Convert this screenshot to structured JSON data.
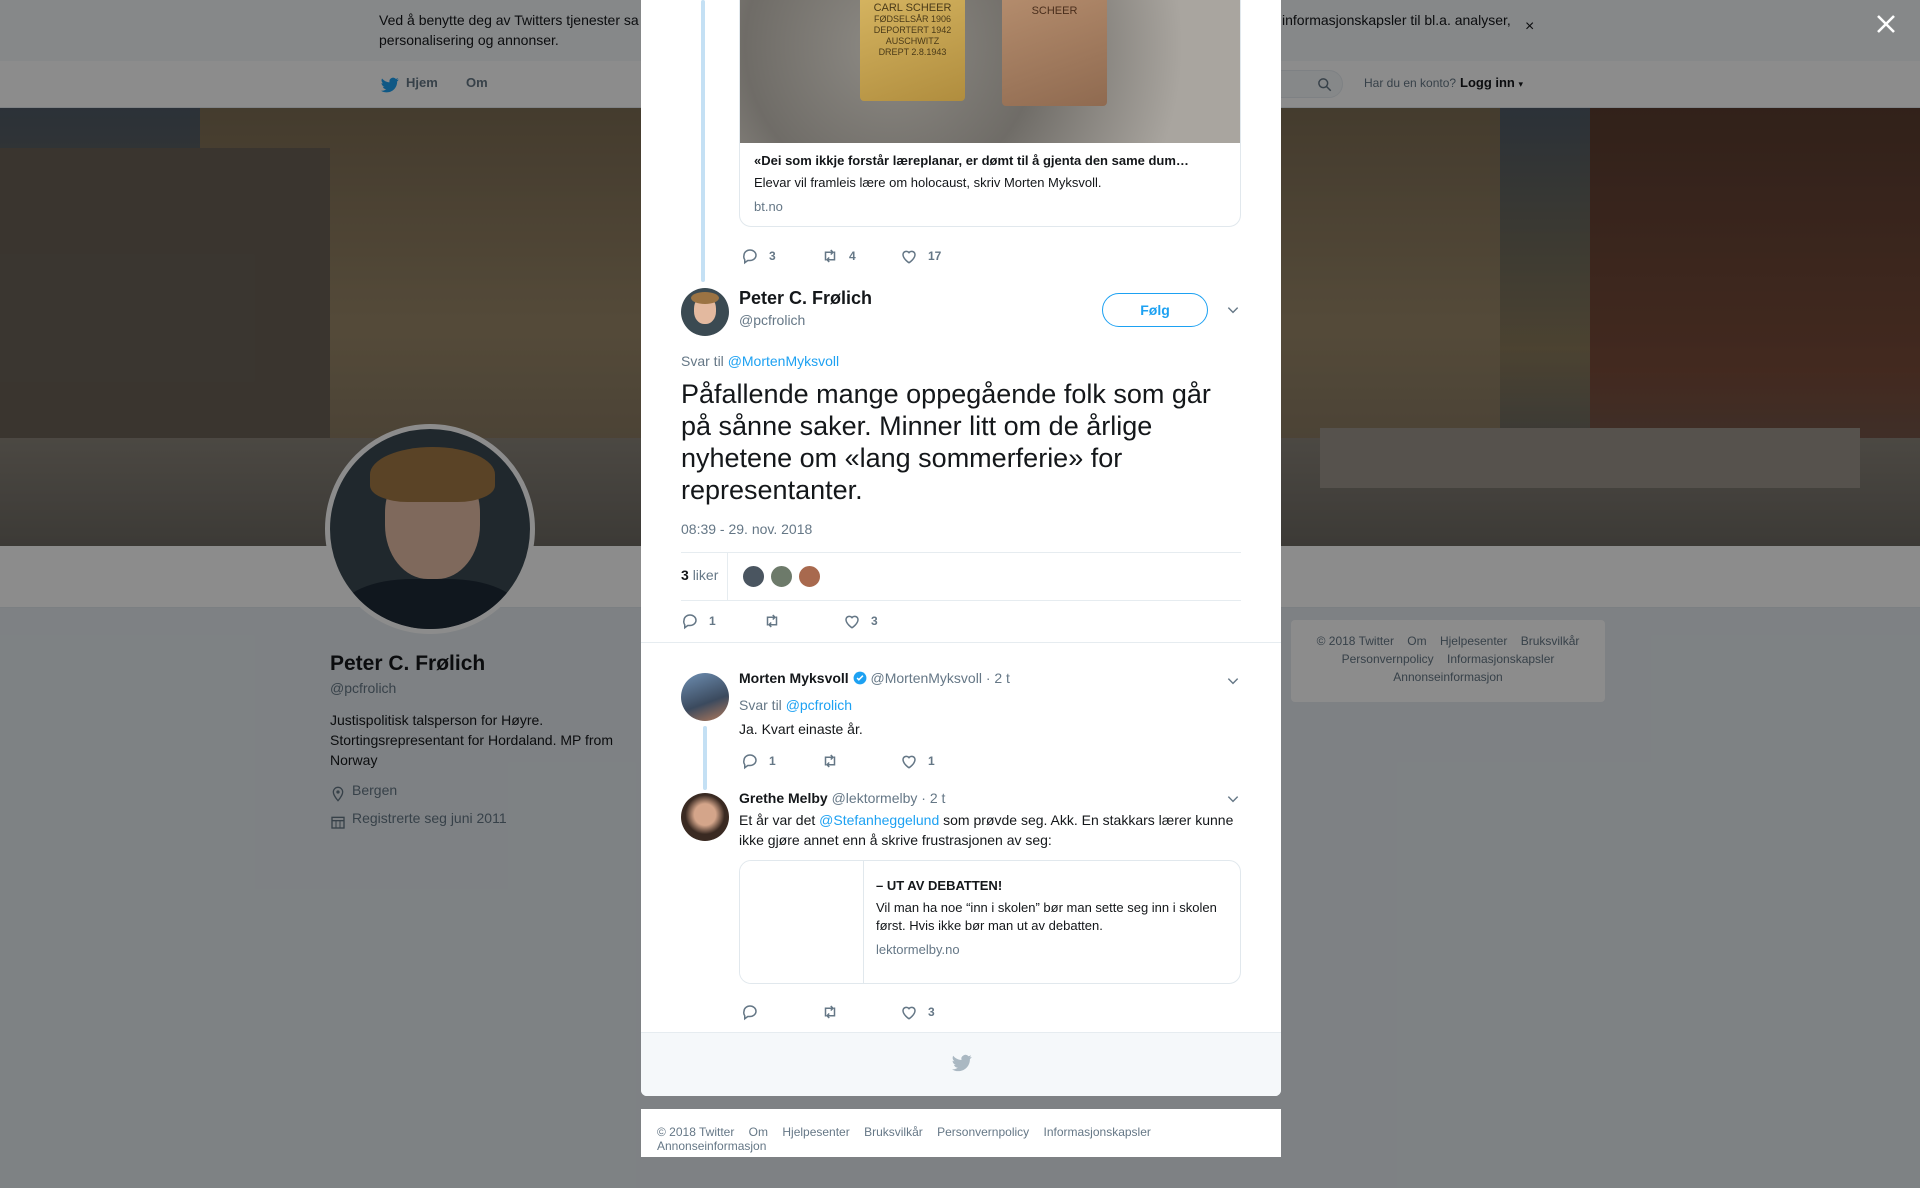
{
  "cookie_banner": {
    "text_left": "Ved å benytte deg av Twitters tjenester sa",
    "text_left_2": "personalisering og annonser.",
    "text_right": "informasjonskapsler til bl.a. analyser,",
    "close_glyph": "×"
  },
  "nav": {
    "home": "Hjem",
    "about": "Om",
    "account_question": "Har du en konto?",
    "login": "Logg inn"
  },
  "profile": {
    "name": "Peter C. Frølich",
    "handle": "@pcfrolich",
    "bio": "Justispolitisk talsperson for Høyre. Stortingsrepresentant for Hordaland. MP from Norway",
    "location": "Bergen",
    "joined": "Registrerte seg juni 2011"
  },
  "side_footer": {
    "items_row1": [
      "© 2018 Twitter",
      "Om",
      "Hjelpesenter",
      "Bruksvilkår"
    ],
    "items_row2": [
      "Personvernpolicy",
      "Informasjonskapsler"
    ],
    "items_row3": [
      "Annonseinformasjon"
    ]
  },
  "modal": {
    "parent_tweet": {
      "card_title": "«Dei som ikkje forstår læreplanar, er dømt til å gjenta den same dum…",
      "card_desc": "Elevar vil framleis lære om holocaust, skriv Morten Myksvoll.",
      "card_domain": "bt.no",
      "stones_left": [
        "CARL SCHEER",
        "FØDSELSÅR 1906",
        "DEPORTERT 1942",
        "AUSCHWITZ",
        "DREPT 2.8.1943"
      ],
      "stones_right": [
        "SCHEER"
      ],
      "replies": "3",
      "retweets": "4",
      "likes": "17"
    },
    "main_tweet": {
      "name": "Peter C. Frølich",
      "handle": "@pcfrolich",
      "follow_label": "Følg",
      "reply_to_label": "Svar til",
      "reply_to_handle": "@MortenMyksvoll",
      "text": "Påfallende mange oppegående folk som går på sånne saker. Minner litt om de årlige nyhetene om «lang sommerferie» for representanter.",
      "timestamp": "08:39 - 29. nov. 2018",
      "likes_count": "3",
      "likes_label": "liker",
      "replies": "1",
      "retweets": "",
      "likes": "3"
    },
    "reply1": {
      "name": "Morten Myksvoll",
      "handle": "@MortenMyksvoll",
      "time": "· 2 t",
      "reply_to_label": "Svar til",
      "reply_to_handle": "@pcfrolich",
      "text": "Ja. Kvart einaste år.",
      "replies": "1",
      "retweets": "",
      "likes": "1"
    },
    "reply2": {
      "name": "Grethe Melby",
      "handle": "@lektormelby",
      "time": "· 2 t",
      "text_before": "Et år var det ",
      "mention": "@Stefanheggelund",
      "text_after": " som prøvde seg. Akk. En stakkars lærer kunne ikke gjøre annet enn å skrive frustrasjonen av seg:",
      "card_title": "– UT AV DEBATTEN!",
      "card_desc": "Vil man ha noe “inn i skolen” bør man sette seg inn i skolen først. Hvis ikke bør man ut av debatten.",
      "card_domain": "lektormelby.no",
      "replies": "",
      "retweets": "",
      "likes": "3"
    }
  },
  "bottom_footer": {
    "items": [
      "© 2018 Twitter",
      "Om",
      "Hjelpesenter",
      "Bruksvilkår",
      "Personvernpolicy",
      "Informasjonskapsler",
      "Annonseinformasjon"
    ]
  },
  "colors": {
    "accent": "#1da1f2",
    "text": "#14171a",
    "muted": "#657786",
    "overlay": "rgba(0,0,0,0.45)"
  }
}
